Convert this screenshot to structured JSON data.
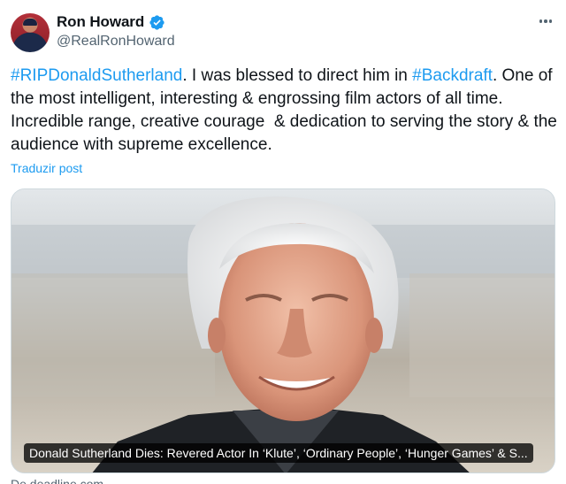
{
  "author": {
    "display_name": "Ron Howard",
    "handle": "@RealRonHoward",
    "verified_icon": "verified-badge-icon",
    "avatar_icon": "user-avatar"
  },
  "menu": {
    "more_icon": "more-horizontal-icon"
  },
  "post": {
    "hashtag1": "#RIPDonaldSutherland",
    "text1": ". I was blessed to direct him in ",
    "hashtag2": "#Backdraft",
    "text2": ". One of the most intelligent, interesting & engrossing film actors of all time. Incredible range, creative courage  & dedication to serving the story & the audience with supreme excellence.",
    "translate_label": "Traduzir post"
  },
  "card": {
    "caption": "Donald Sutherland Dies: Revered Actor In ‘Klute’, ‘Ordinary People’, ‘Hunger Games’ & S...",
    "source": "De deadline.com"
  },
  "colors": {
    "link": "#1d9bf0",
    "text": "#0f1419",
    "secondary": "#536471",
    "verified": "#1d9bf0"
  }
}
